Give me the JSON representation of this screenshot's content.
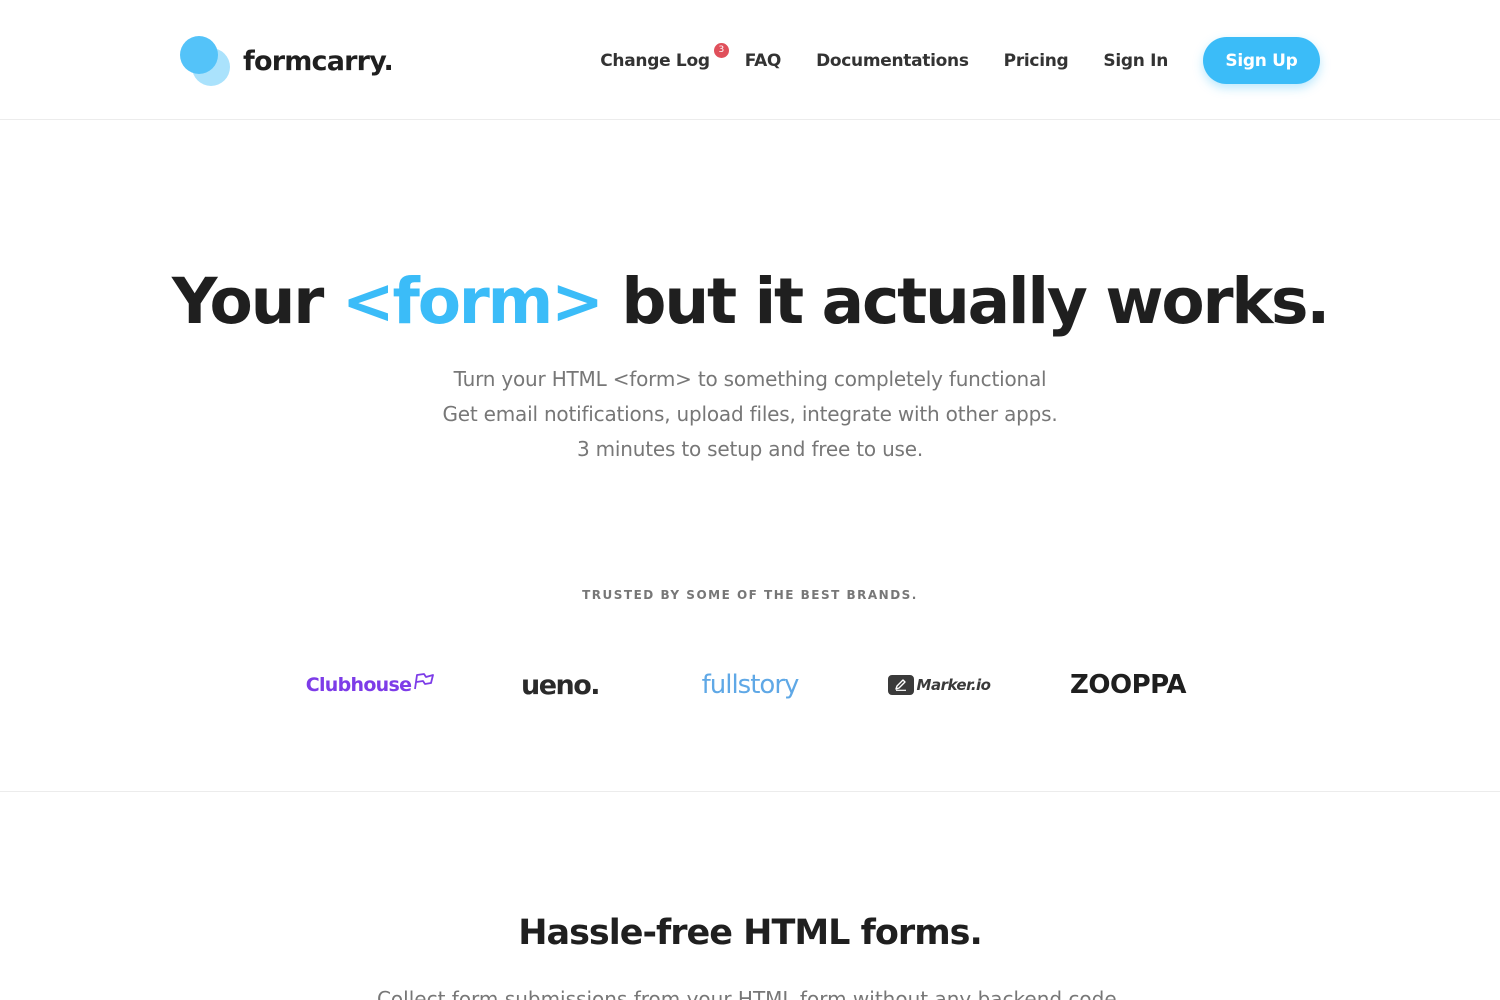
{
  "header": {
    "brand": {
      "name": "formcarry.",
      "logo_icon": "overlapping-circles-logo-icon"
    },
    "nav": {
      "change_log": "Change Log",
      "change_log_badge": "3",
      "faq": "FAQ",
      "documentations": "Documentations",
      "pricing": "Pricing",
      "sign_in": "Sign In",
      "sign_up": "Sign Up"
    }
  },
  "hero": {
    "title_before": "Your",
    "title_accent": "<form>",
    "title_after": "but it actually works.",
    "subtitle_lines": [
      "Turn your HTML <form> to something completely functional",
      "Get email notifications, upload files, integrate with other apps.",
      "3 minutes to setup and free to use."
    ]
  },
  "trusted": {
    "label": "TRUSTED BY SOME OF THE BEST BRANDS.",
    "brands": [
      "Clubhouse",
      "ueno.",
      "fullstory",
      "Marker.io",
      "ZOOPPA"
    ]
  },
  "section2": {
    "title": "Hassle-free HTML forms.",
    "subtitle": "Collect form submissions from your HTML form without any backend code."
  },
  "colors": {
    "accent": "#3bbcf8",
    "logo_light": "#a3e0fc",
    "badge": "#e0505b",
    "clubhouse": "#7d3ce8",
    "fullstory": "#5fa8e6"
  }
}
